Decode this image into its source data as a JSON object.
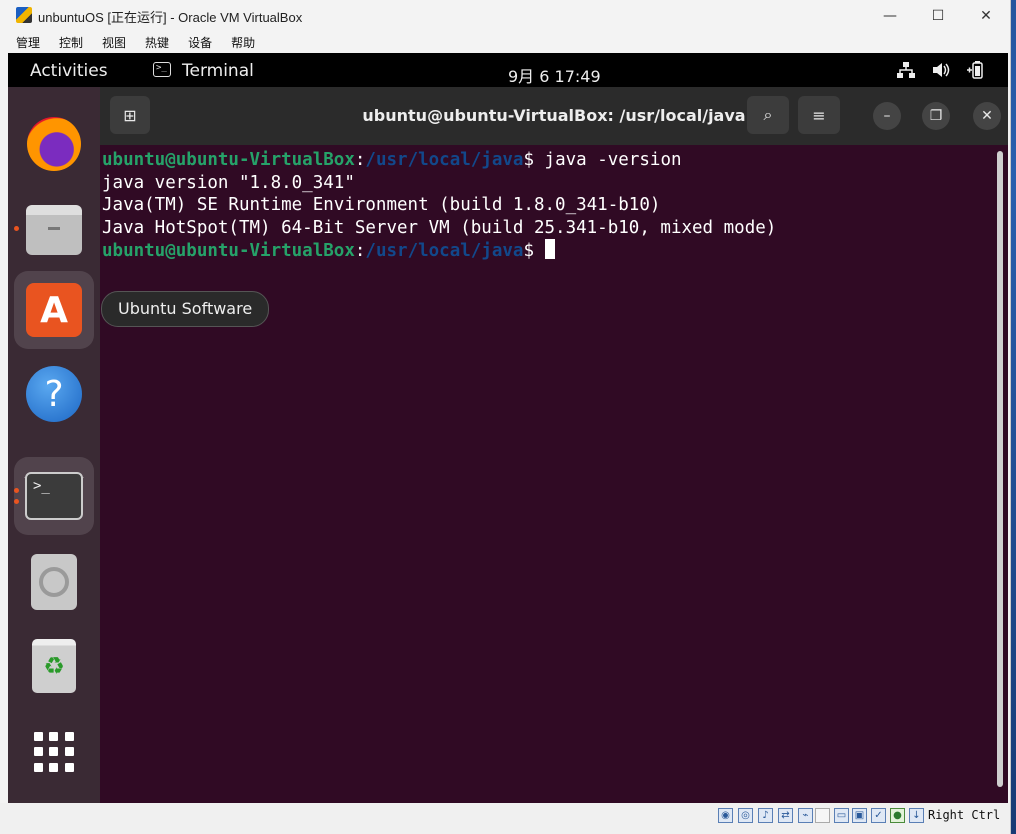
{
  "window": {
    "title": "unbuntuOS [正在运行] - Oracle VM VirtualBox",
    "minimize_glyph": "—",
    "maximize_glyph": "☐",
    "close_glyph": "✕"
  },
  "menubar": {
    "items": [
      "管理",
      "控制",
      "视图",
      "热键",
      "设备",
      "帮助"
    ]
  },
  "gnome_topbar": {
    "activities": "Activities",
    "app_name": "Terminal",
    "clock": "9月 6  17:49"
  },
  "dock": {
    "items": [
      {
        "name": "firefox",
        "icon": "firefox-icon"
      },
      {
        "name": "files",
        "icon": "files-icon"
      },
      {
        "name": "ubuntu-software",
        "icon": "ubuntu-software-icon",
        "glyph": "A"
      },
      {
        "name": "help",
        "icon": "help-icon",
        "glyph": "?"
      },
      {
        "name": "terminal",
        "icon": "terminal-icon",
        "glyph": ">_"
      },
      {
        "name": "disc",
        "icon": "disc-icon"
      },
      {
        "name": "trash",
        "icon": "trash-icon",
        "glyph": "♻"
      },
      {
        "name": "show-apps",
        "icon": "app-grid-icon"
      }
    ],
    "tooltip": "Ubuntu Software"
  },
  "terminal": {
    "title": "ubuntu@ubuntu-VirtualBox: /usr/local/java",
    "new_tab_glyph": "⊞",
    "search_glyph": "⌕",
    "menu_glyph": "≡",
    "minimize_glyph": "–",
    "restore_glyph": "❐",
    "close_glyph": "✕",
    "prompt_user": "ubuntu@ubuntu-VirtualBox",
    "prompt_colon": ":",
    "prompt_path": "/usr/local/java",
    "prompt_dollar": "$ ",
    "command": "java -version",
    "output": [
      "java version \"1.8.0_341\"",
      "Java(TM) SE Runtime Environment (build 1.8.0_341-b10)",
      "Java HotSpot(TM) 64-Bit Server VM (build 25.341-b10, mixed mode)"
    ]
  },
  "statusbar": {
    "host_key": "Right Ctrl"
  }
}
